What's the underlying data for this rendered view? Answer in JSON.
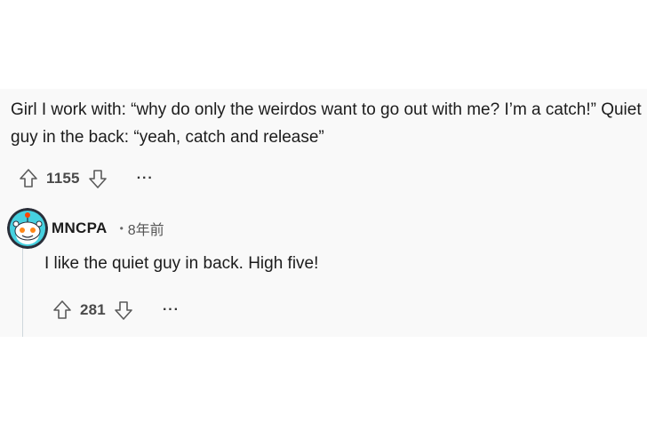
{
  "comment": {
    "text": "Girl I work with: “why do only the weirdos want to go out with me? I’m a catch!” Quiet guy in the back: “yeah, catch and release”",
    "score": "1155",
    "more_label": "···",
    "icons": {
      "upvote": "arrow-up-icon",
      "downvote": "arrow-down-icon"
    }
  },
  "reply": {
    "username": "MNCPA",
    "separator": "•",
    "timestamp": "8年前",
    "text": "I like the quiet guy in back. High five!",
    "score": "281",
    "more_label": "···",
    "avatar": "snoo-avatar",
    "accent_color": "#46d1e0"
  }
}
